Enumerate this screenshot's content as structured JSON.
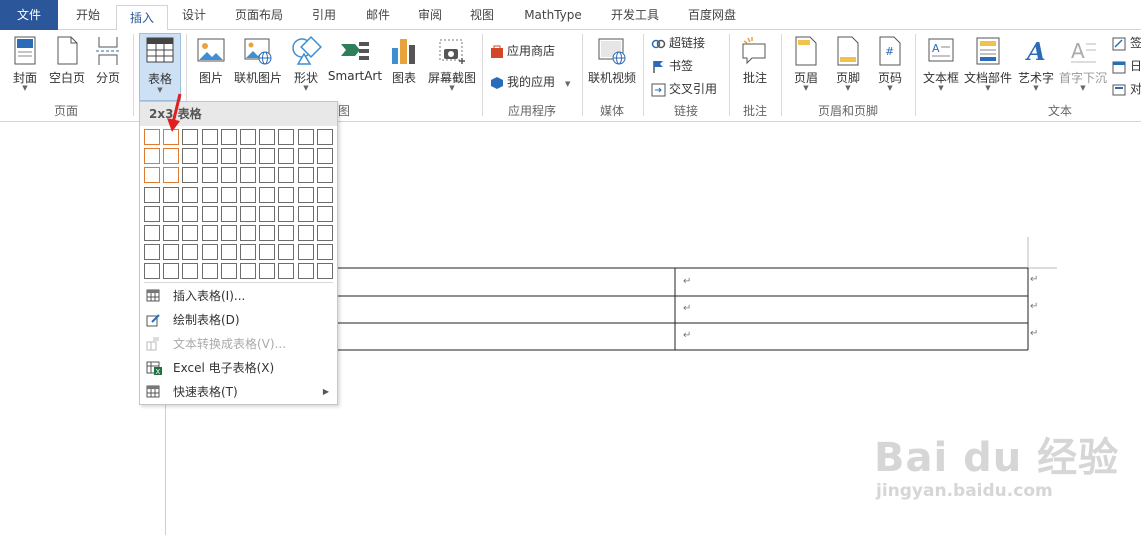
{
  "tabs": [
    {
      "label": "文件"
    },
    {
      "label": "开始"
    },
    {
      "label": "插入"
    },
    {
      "label": "设计"
    },
    {
      "label": "页面布局"
    },
    {
      "label": "引用"
    },
    {
      "label": "邮件"
    },
    {
      "label": "审阅"
    },
    {
      "label": "视图"
    },
    {
      "label": "MathType"
    },
    {
      "label": "开发工具"
    },
    {
      "label": "百度网盘"
    }
  ],
  "ribbon": {
    "cover": "封面",
    "blank": "空白页",
    "pagebreak": "分页",
    "group_page": "页面",
    "table": "表格",
    "picture": "图片",
    "online_picture": "联机图片",
    "shapes": "形状",
    "smartart": "SmartArt",
    "chart": "图表",
    "screenshot": "屏幕截图",
    "group_illus_tail": "图",
    "app_store": "应用商店",
    "my_apps": "我的应用",
    "group_apps": "应用程序",
    "online_video": "联机视频",
    "group_media": "媒体",
    "hyperlink": "超链接",
    "bookmark": "书签",
    "crossref": "交叉引用",
    "group_links": "链接",
    "comment": "批注",
    "group_comments": "批注",
    "header": "页眉",
    "footer": "页脚",
    "page_number": "页码",
    "group_hf": "页眉和页脚",
    "textbox": "文本框",
    "quickparts": "文档部件",
    "wordart": "艺术字",
    "dropcap": "首字下沉",
    "group_text": "文本",
    "sig_partial": "签",
    "date_partial": "日",
    "obj_partial": "对"
  },
  "menu": {
    "title": "2x3 表格",
    "items": [
      {
        "label": "插入表格(I)..."
      },
      {
        "label": "绘制表格(D)"
      },
      {
        "label": "文本转换成表格(V)..."
      },
      {
        "label": "Excel 电子表格(X)"
      },
      {
        "label": "快速表格(T)"
      }
    ]
  },
  "document": {
    "cell_mark": "↵"
  },
  "watermark": {
    "brand": "Bai du 经验",
    "url": "jingyan.baidu.com"
  },
  "colors": {
    "file_tab": "#2b579a",
    "selection": "#e07a30",
    "arrow": "#e02020"
  }
}
